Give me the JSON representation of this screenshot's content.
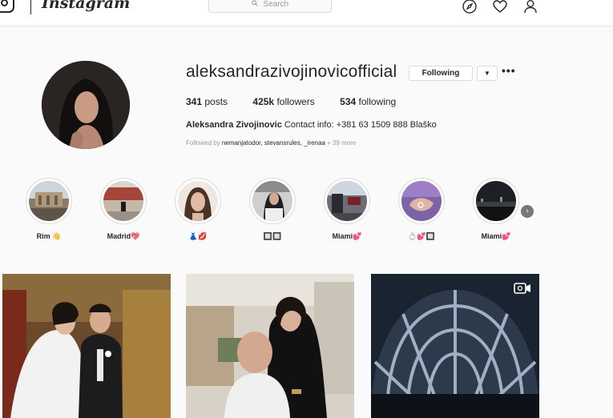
{
  "topbar": {
    "brand": "Instagram",
    "search_placeholder": "Search"
  },
  "icons": {
    "logo": "instagram-camera-icon",
    "search": "search-icon",
    "explore": "compass-icon",
    "activity": "heart-icon",
    "profile": "person-icon"
  },
  "profile": {
    "username": "aleksandrazivojinovicofficial",
    "following_label": "Following",
    "more_label": "•••",
    "stats": {
      "posts_count": "341",
      "posts_label": "posts",
      "followers_count": "425k",
      "followers_label": "followers",
      "following_count": "534",
      "following_label": "following"
    },
    "full_name": "Aleksandra Zivojinovic",
    "bio": "Contact info: +381 63 1509 888 Blaško",
    "followed_by_prefix": "Followed by",
    "followed_by_names": "nemanjatodor, stevansrules, _irenaa",
    "followed_by_more": "+ 39 more"
  },
  "highlights": [
    {
      "label": "Rim 👋"
    },
    {
      "label": "Madrid💖"
    },
    {
      "label": "👗💋"
    },
    {
      "label": "🔲🔲"
    },
    {
      "label": "Miami💕"
    },
    {
      "label": "💍💕🔲"
    },
    {
      "label": "Miami💕"
    }
  ],
  "colors": {
    "background": "#fafafa",
    "border": "#dbdbdb",
    "text": "#262626",
    "muted": "#999999"
  }
}
